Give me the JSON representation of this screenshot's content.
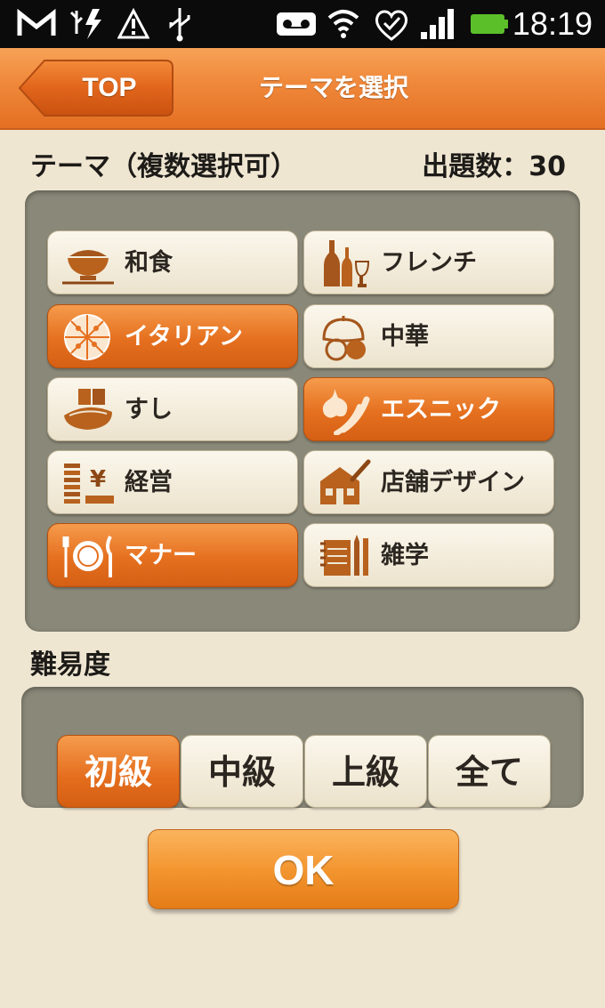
{
  "status_bar": {
    "time": "18:19",
    "icons": [
      "gmail-icon",
      "usb-debug-icon",
      "warning-icon",
      "usb-icon",
      "voicemail-icon",
      "wifi-icon",
      "signal-quality-icon",
      "cell-signal-icon",
      "battery-icon"
    ]
  },
  "header": {
    "back_label": "TOP",
    "title": "テーマを選択"
  },
  "theme_section": {
    "label": "テーマ（複数選択可）",
    "count_label": "出題数：30"
  },
  "themes": [
    {
      "label": "和食",
      "icon": "rice-bowl-icon",
      "selected": false
    },
    {
      "label": "フレンチ",
      "icon": "wine-bottles-icon",
      "selected": false
    },
    {
      "label": "イタリアン",
      "icon": "pizza-icon",
      "selected": true
    },
    {
      "label": "中華",
      "icon": "dumpling-icon",
      "selected": false
    },
    {
      "label": "すし",
      "icon": "sushi-icon",
      "selected": false
    },
    {
      "label": "エスニック",
      "icon": "garlic-chili-icon",
      "selected": true
    },
    {
      "label": "経営",
      "icon": "yen-coins-icon",
      "selected": false
    },
    {
      "label": "店舗デザイン",
      "icon": "shop-brush-icon",
      "selected": false
    },
    {
      "label": "マナー",
      "icon": "plate-cutlery-icon",
      "selected": true
    },
    {
      "label": "雑学",
      "icon": "notebook-pencils-icon",
      "selected": false
    }
  ],
  "difficulty": {
    "label": "難易度",
    "options": [
      {
        "label": "初級",
        "selected": true
      },
      {
        "label": "中級",
        "selected": false
      },
      {
        "label": "上級",
        "selected": false
      },
      {
        "label": "全て",
        "selected": false
      }
    ]
  },
  "ok_label": "OK",
  "colors": {
    "accent_orange": "#e5701f",
    "header_orange": "#f08a3c",
    "background": "#efe6d2",
    "panel": "#8a8878"
  }
}
